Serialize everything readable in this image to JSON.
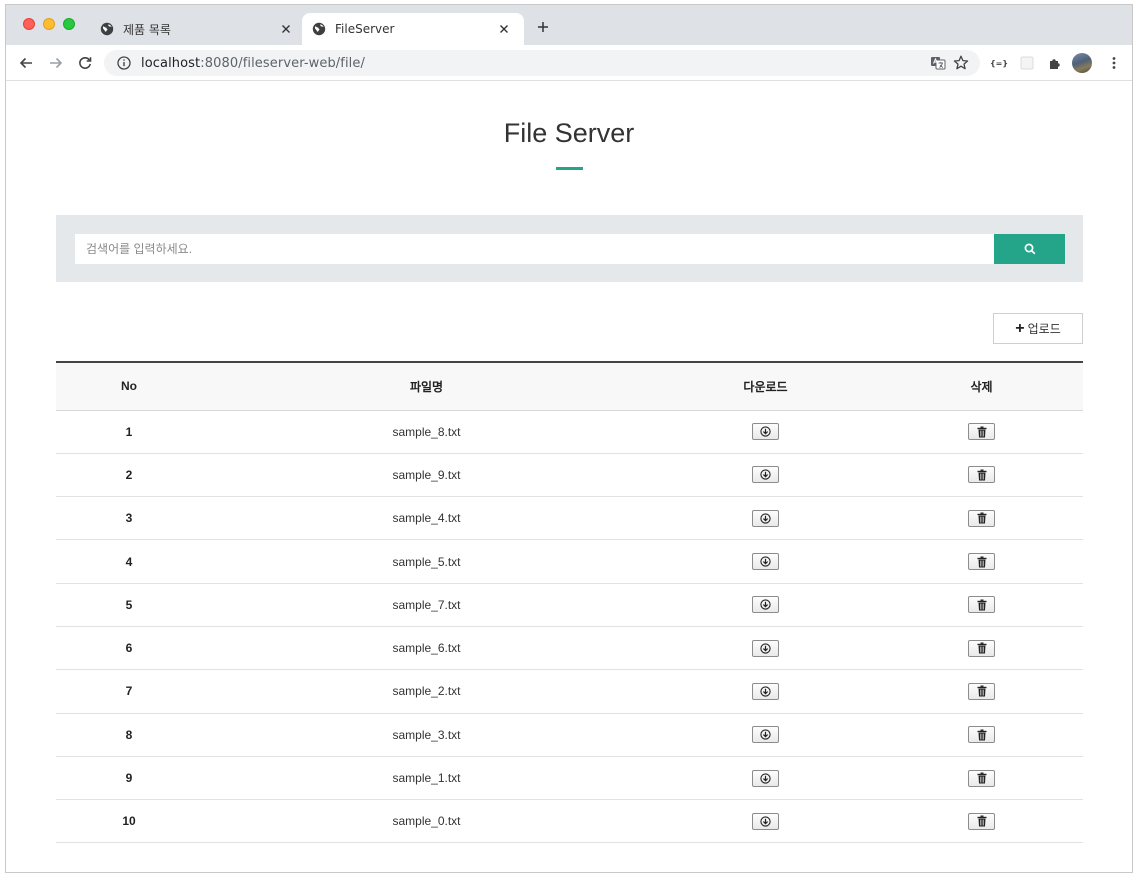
{
  "browser": {
    "tabs": [
      {
        "title": "제품 목록",
        "active": false
      },
      {
        "title": "FileServer",
        "active": true
      }
    ],
    "url": {
      "host": "localhost",
      "path": ":8080/fileserver-web/file/"
    }
  },
  "page": {
    "title": "File Server",
    "accent_color": "#24a58a",
    "search": {
      "placeholder": "검색어를 입력하세요.",
      "value": ""
    },
    "upload_label": "업로드",
    "table": {
      "headers": {
        "no": "No",
        "name": "파일명",
        "download": "다운로드",
        "delete": "삭제"
      },
      "rows": [
        {
          "no": "1",
          "name": "sample_8.txt"
        },
        {
          "no": "2",
          "name": "sample_9.txt"
        },
        {
          "no": "3",
          "name": "sample_4.txt"
        },
        {
          "no": "4",
          "name": "sample_5.txt"
        },
        {
          "no": "5",
          "name": "sample_7.txt"
        },
        {
          "no": "6",
          "name": "sample_6.txt"
        },
        {
          "no": "7",
          "name": "sample_2.txt"
        },
        {
          "no": "8",
          "name": "sample_3.txt"
        },
        {
          "no": "9",
          "name": "sample_1.txt"
        },
        {
          "no": "10",
          "name": "sample_0.txt"
        }
      ]
    }
  }
}
